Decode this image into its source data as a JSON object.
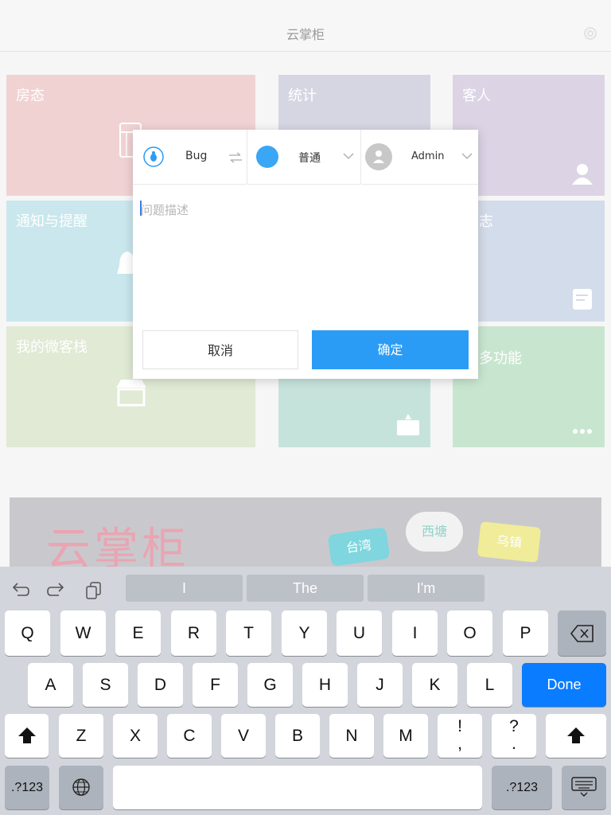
{
  "navbar": {
    "title": "云掌柜"
  },
  "tiles": {
    "room_status": "房态",
    "stats": "统计",
    "guests": "客人",
    "notifications": "通知与提醒",
    "log_partial": "志",
    "my_inn": "我的微客栈",
    "more_partial": "多功能"
  },
  "banner": {
    "title": "云掌柜",
    "bubbles": [
      "台湾",
      "西塘",
      "乌镇"
    ]
  },
  "dialog": {
    "type_label": "Bug",
    "priority_label": "普通",
    "assignee_label": "Admin",
    "description_placeholder": "问题描述",
    "cancel_label": "取消",
    "confirm_label": "确定",
    "colors": {
      "accent": "#2b9cf5",
      "priority_dot": "#3aa6f6"
    }
  },
  "keyboard": {
    "suggestions": [
      "I",
      "The",
      "I'm"
    ],
    "row1": [
      "Q",
      "W",
      "E",
      "R",
      "T",
      "Y",
      "U",
      "I",
      "O",
      "P"
    ],
    "row2": [
      "A",
      "S",
      "D",
      "F",
      "G",
      "H",
      "J",
      "K",
      "L"
    ],
    "row3": [
      "Z",
      "X",
      "C",
      "V",
      "B",
      "N",
      "M",
      "!\n,",
      "?\n."
    ],
    "done_label": "Done",
    "numbers_label": ".?123",
    "icons": [
      "undo-icon",
      "redo-icon",
      "paste-icon",
      "delete-icon",
      "shift-icon",
      "globe-icon",
      "keyboard-dismiss-icon"
    ]
  }
}
